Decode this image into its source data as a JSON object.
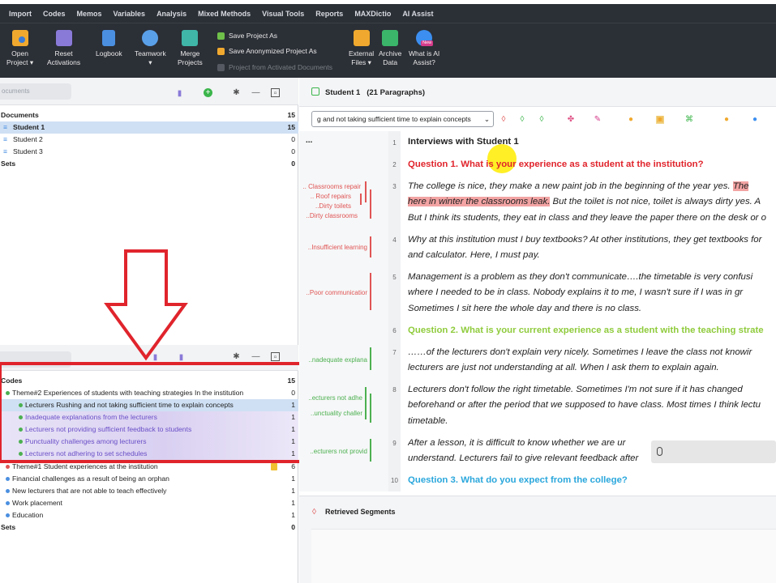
{
  "menu": [
    "Import",
    "Codes",
    "Memos",
    "Variables",
    "Analysis",
    "Mixed Methods",
    "Visual Tools",
    "Reports",
    "MAXDictio",
    "AI Assist"
  ],
  "ribbon": {
    "open_project": [
      "Open",
      "Project ▾"
    ],
    "reset_activations": [
      "Reset",
      "Activations"
    ],
    "logbook": "Logbook",
    "teamwork": [
      "Teamwork",
      "▾"
    ],
    "merge_projects": [
      "Merge",
      "Projects"
    ],
    "save_project_as": "Save Project As",
    "save_anonymized": "Save Anonymized Project As",
    "project_from_activated": "Project from Activated Documents",
    "external_files": [
      "External",
      "Files ▾"
    ],
    "archive_data": [
      "Archive",
      "Data"
    ],
    "ai_assist": [
      "What is AI",
      "Assist?"
    ],
    "new_badge": "New"
  },
  "documents": {
    "search_placeholder": "ocuments",
    "rows": [
      {
        "label": "Documents",
        "count": "15"
      },
      {
        "label": "Student 1",
        "count": "15"
      },
      {
        "label": "Student 2",
        "count": "0"
      },
      {
        "label": "Student 3",
        "count": "0"
      },
      {
        "label": "Sets",
        "count": "0"
      }
    ]
  },
  "codes": {
    "rows": [
      {
        "label": "Codes",
        "count": "15"
      },
      {
        "label": "Theme#2 Experiences of students with teaching strategies In the institution",
        "count": "0"
      },
      {
        "label": "Lecturers Rushing and not taking sufficient time to explain concepts",
        "count": "1"
      },
      {
        "label": "Inadequate explanations from the lecturers",
        "count": "1"
      },
      {
        "label": "Lecturers not providing sufficient feedback to students",
        "count": "1"
      },
      {
        "label": "Punctuality challenges among lecturers",
        "count": "1"
      },
      {
        "label": "Lecturers not adhering to set schedules",
        "count": "1"
      },
      {
        "label": "Theme#1 Student experiences at the institution",
        "count": "6"
      },
      {
        "label": "Financial challenges as a result of being an orphan",
        "count": "1"
      },
      {
        "label": "New lecturers that are not able to teach effectively",
        "count": "1"
      },
      {
        "label": "Work placement",
        "count": "1"
      },
      {
        "label": "Education",
        "count": "1"
      },
      {
        "label": "Sets",
        "count": "0"
      }
    ]
  },
  "browser": {
    "title": "Student 1",
    "paragraphs": "(21 Paragraphs)",
    "code_select": "g and not taking sufficient time to explain concepts",
    "ellipsis": "...",
    "retrieved_title": "Retrieved Segments"
  },
  "margin_codes": {
    "classrooms_repair": ".. Classrooms repair",
    "roof_repairs": ".. Roof repairs",
    "dirty_toilets": "..Dirty toilets",
    "dirty_classrooms": "..Dirty classrooms",
    "insufficient_learning": "..Insufficient learning",
    "poor_communication": "..Poor communicatior",
    "inadequate_explanation": "..nadequate explana",
    "lecturers_not_adhere": "..ecturers not adhe",
    "punctuality": "..unctuality challer",
    "lecturers_not_provid": "..ecturers not provid"
  },
  "text": {
    "n1": "1",
    "p1": "Interviews with Student 1",
    "n2": "2",
    "p2": "Question 1. What is your experience as a student at the institution?",
    "n3": "3",
    "p3a_pre": "The college is nice, they make a new paint job in the beginning of the year yes. ",
    "p3a_hl": "The",
    "p3b_hl": "here in winter the classrooms leak.",
    "p3b_post": " But the toilet is not nice, toilet is always dirty yes. A",
    "p3c": "But I think its students, they eat in class and they leave the paper there on the desk or o",
    "n4": "4",
    "p4a": "Why at this institution must I buy textbooks? At other institutions, they get textbooks for",
    "p4b": "and calculator. Here, I must pay.",
    "n5": "5",
    "p5a": " Management is a problem as they don't communicate….the timetable is very confusi",
    "p5b": "where I needed to be in class. Nobody explains it to me, I wasn't sure if I was in gr",
    "p5c": "Sometimes I sit here the whole day and there is no class.",
    "n6": "6",
    "p6": "Question 2. What is your current experience as a student with the teaching strate",
    "n7": "7",
    "p7a": "……of the lecturers don't explain very nicely. Sometimes I leave the class not knowir",
    "p7b": "lecturers are just not understanding at all. When I ask them to explain again.",
    "n8": "8",
    "p8a": "Lecturers don't follow the right timetable. Sometimes I'm not sure if it has changed",
    "p8b": "beforehand or after the period that we supposed to have class. Most times I think lectu",
    "p8c": "timetable.",
    "n9": "9",
    "p9a": "After a lesson, it is difficult to know whether we are ur",
    "p9b": "understand. Lecturers fail to give relevant feedback after",
    "n10": "10",
    "p10": "Question 3. What do you expect from the college?"
  },
  "colors": {
    "menubar": "#2b2f36",
    "red_frame": "#e0242c",
    "q1": "#e0242c",
    "q2": "#8fcb3c",
    "q3": "#2aa7dc",
    "highlight": "#f3a3a3"
  }
}
